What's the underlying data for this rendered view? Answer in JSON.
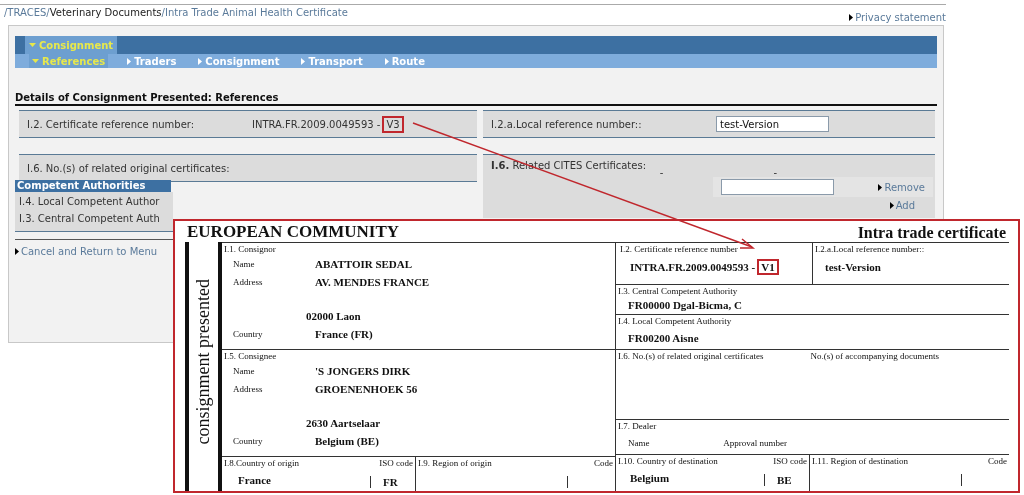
{
  "breadcrumb": [
    {
      "label": "/TRACES/",
      "kind": "link"
    },
    {
      "label": "Veterinary Documents",
      "kind": "current"
    },
    {
      "label": "/Intra Trade Animal Health Certificate",
      "kind": "link"
    }
  ],
  "privacy_link": "Privacy statement",
  "nav": {
    "section": "Consignment",
    "tabs": [
      {
        "label": "References",
        "selected": true
      },
      {
        "label": "Traders",
        "selected": false
      },
      {
        "label": "Consignment",
        "selected": false
      },
      {
        "label": "Transport",
        "selected": false
      },
      {
        "label": "Route",
        "selected": false
      }
    ]
  },
  "section_title": "Details of Consignment Presented: References",
  "certificate_reference": {
    "label": "I.2. Certificate reference number:",
    "value": "INTRA.FR.2009.0049593 -",
    "version": "V3"
  },
  "local_reference": {
    "label": "I.2.a.Local reference number::",
    "value": "test-Version"
  },
  "related_original": {
    "label": "I.6. No.(s) of related original certificates:"
  },
  "cites": {
    "label": "**I.6.** Related CITES Certificates:",
    "column_1": "-",
    "column_2": "-",
    "remove": "Remove",
    "add": "Add"
  },
  "competent_authorities": {
    "title": "Competent Authorities",
    "rows": [
      "I.4. Local Competent Author",
      "I.3. Central Competent Auth"
    ]
  },
  "cancel_link": "Cancel and Return to Menu",
  "certificate": {
    "title": "EUROPEAN COMMUNITY",
    "type": "Intra trade certificate",
    "side_label": "consignment presented",
    "parties": [
      {
        "heading": "I.1. Consignor",
        "rows": [
          {
            "label": "Name",
            "value": "ABATTOIR SEDAL"
          },
          {
            "label": "Address",
            "value": "AV. MENDES FRANCE"
          },
          {
            "value": "02000 Laon"
          },
          {
            "label": "Country",
            "value": "France (FR)"
          }
        ]
      },
      {
        "heading": "I.5. Consignee",
        "rows": [
          {
            "label": "Name",
            "value": "'S JONGERS DIRK"
          },
          {
            "label": "Address",
            "value": "GROENENHOEK 56"
          },
          {
            "value": "2630 Aartselaar"
          },
          {
            "label": "Country",
            "value": "Belgium (BE)"
          }
        ]
      }
    ],
    "origin": {
      "country_heading": "I.8.Country of origin",
      "iso_heading": "ISO code",
      "country": "France",
      "iso": "FR",
      "region_heading": "I.9. Region of origin",
      "code_heading": "Code"
    },
    "reference": {
      "heading": "I.2. Certificate reference number",
      "value": "INTRA.FR.2009.0049593 -",
      "version": "V1"
    },
    "local_reference": {
      "heading": "I.2.a.Local reference number::",
      "value": "test-Version"
    },
    "central_authority": {
      "heading": "I.3. Central Competent Authority",
      "value": "FR00000 Dgal-Bicma, C"
    },
    "local_authority": {
      "heading": "I.4. Local Competent Authority",
      "value": "FR00200 Aisne"
    },
    "related": {
      "heading": "I.6. No.(s) of related original certificates",
      "heading_2": "No.(s) of accompanying documents"
    },
    "dealer": {
      "heading": "I.7. Dealer",
      "name_label": "Name",
      "approval_label": "Approval number"
    },
    "destination": {
      "country_heading": "I.10. Country of destination",
      "iso_heading": "ISO code",
      "country": "Belgium",
      "iso": "BE",
      "region_heading": "I.11. Region of destination",
      "code_heading": "Code"
    }
  }
}
